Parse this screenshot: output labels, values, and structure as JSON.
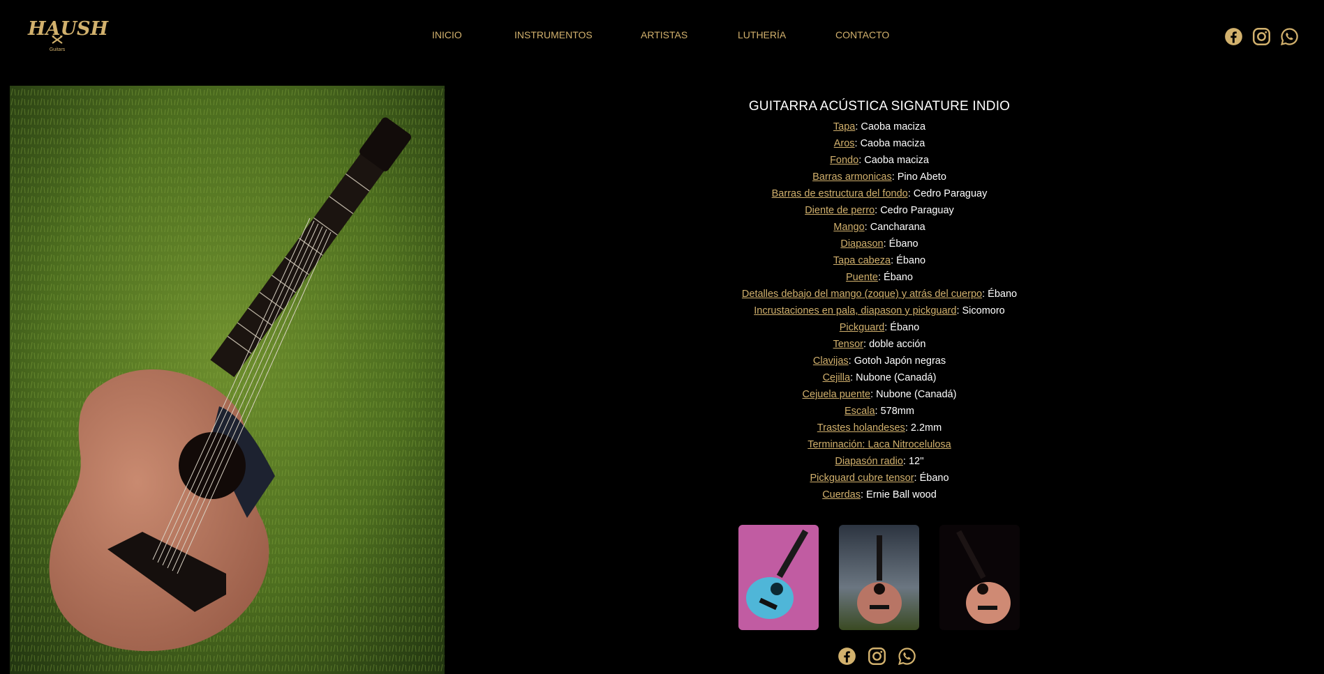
{
  "brand": {
    "name": "HAUSH",
    "tagline": "Guitars"
  },
  "nav": [
    "INICIO",
    "INSTRUMENTOS",
    "ARTISTAS",
    "LUTHERÍA",
    "CONTACTO"
  ],
  "social_icons": [
    "facebook-icon",
    "instagram-icon",
    "whatsapp-icon"
  ],
  "colors": {
    "accent": "#d2b16d",
    "background": "#000000",
    "text": "#ffffff"
  },
  "product": {
    "title": "GUITARRA ACÚSTICA SIGNATURE INDIO",
    "specs": [
      {
        "key": "Tapa",
        "value": ": Caoba maciza"
      },
      {
        "key": "Aros",
        "value": ": Caoba maciza"
      },
      {
        "key": "Fondo",
        "value": ": Caoba maciza"
      },
      {
        "key": "Barras armonicas",
        "value": ": Pino Abeto"
      },
      {
        "key": "Barras de estructura del fondo",
        "value": ": Cedro Paraguay"
      },
      {
        "key": "Diente de perro",
        "value": ": Cedro Paraguay"
      },
      {
        "key": "Mango",
        "value": ": Cancharana"
      },
      {
        "key": "Diapason",
        "value": ": Ébano"
      },
      {
        "key": "Tapa cabeza",
        "value": ": Ébano"
      },
      {
        "key": "Puente",
        "value": ": Ébano"
      },
      {
        "key": "Detalles debajo del mango (zoque) y atrás del cuerpo",
        "value": ": Ébano"
      },
      {
        "key": "Incrustaciones en pala, diapason y pickguard",
        "value": ": Sicomoro"
      },
      {
        "key": "Pickguard",
        "value": ": Ébano"
      },
      {
        "key": "Tensor",
        "value": ": doble acción"
      },
      {
        "key": "Clavijas",
        "value": ": Gotoh Japón negras"
      },
      {
        "key": "Cejilla",
        "value": ": Nubone (Canadá)"
      },
      {
        "key": "Cejuela puente",
        "value": ": Nubone (Canadá)"
      },
      {
        "key": "Escala",
        "value": ": 578mm"
      },
      {
        "key": "Trastes holandeses",
        "value": ": 2.2mm"
      },
      {
        "key": "Terminación: Laca Nitrocelulosa",
        "value": ""
      },
      {
        "key": "Diapasón radio",
        "value": ": 12''"
      },
      {
        "key": "Pickguard cubre tensor",
        "value": ": Ébano"
      },
      {
        "key": "Cuerdas",
        "value": ": Ernie Ball wood"
      }
    ],
    "thumbnails": [
      "guitar-blue-thumbnail",
      "guitar-storm-thumbnail",
      "guitar-dark-thumbnail"
    ]
  }
}
